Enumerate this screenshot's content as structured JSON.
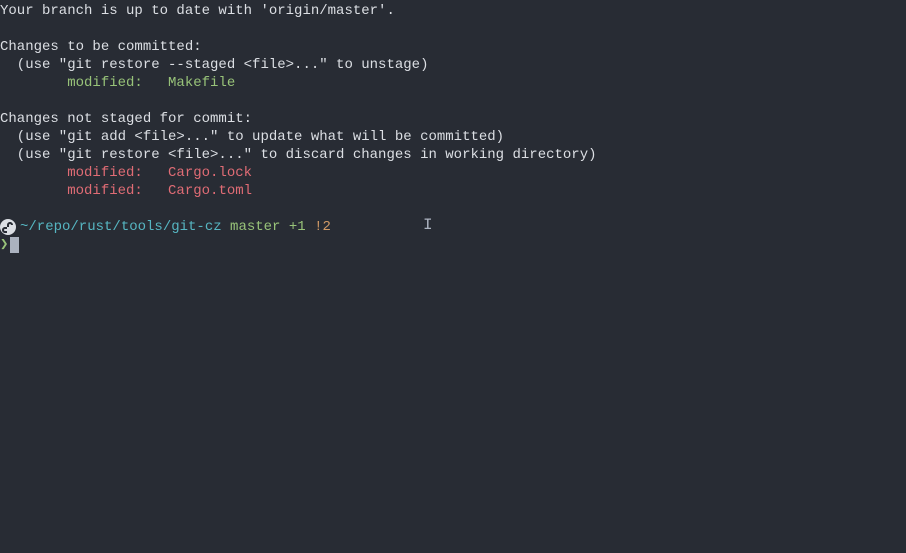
{
  "status": {
    "uptodate": "Your branch is up to date with 'origin/master'.",
    "commit_header": "Changes to be committed:",
    "commit_hint": "  (use \"git restore --staged <file>...\" to unstage)",
    "staged_label": "        modified:   ",
    "staged_file": "Makefile",
    "unstaged_header": "Changes not staged for commit:",
    "unstaged_hint1": "  (use \"git add <file>...\" to update what will be committed)",
    "unstaged_hint2": "  (use \"git restore <file>...\" to discard changes in working directory)",
    "modified_label1": "        modified:   ",
    "modified_file1": "Cargo.lock",
    "modified_label2": "        modified:   ",
    "modified_file2": "Cargo.toml"
  },
  "prompt": {
    "path": "~/repo/rust/tools/git-cz",
    "branch": "master",
    "staged_count": "+1",
    "unstaged_count": "!2",
    "arrow": "❯"
  }
}
